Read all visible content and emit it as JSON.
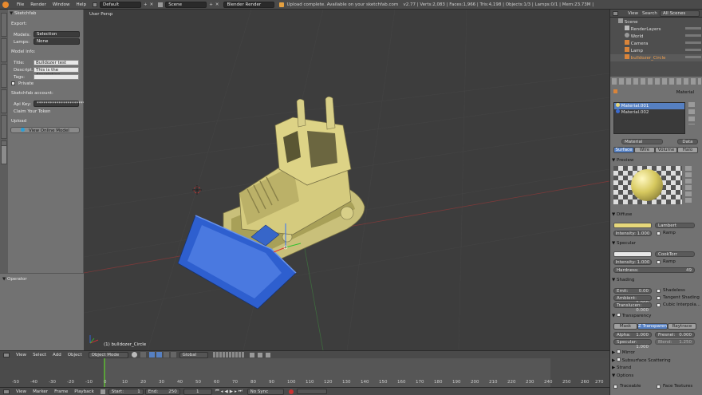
{
  "menubar": {
    "items": [
      "File",
      "Render",
      "Window",
      "Help"
    ],
    "layout": "Default",
    "scene": "Scene",
    "engine": "Blender Render",
    "message": "Upload complete. Available on your sketchfab.com dashboard",
    "stats": "v2.77 | Verts:2,083 | Faces:1,966 | Tris:4,198 | Objects:1/3 | Lamps:0/1 | Mem:23.73M | bulldozer_Circle"
  },
  "sketchfab": {
    "panel_title": "Sketchfab",
    "export_label": "Export:",
    "models_label": "Models:",
    "models_value": "Selection",
    "lamps_label": "Lamps:",
    "lamps_value": "None",
    "model_info_label": "Model info:",
    "title_label": "Title:",
    "title_value": "Bulldozer test",
    "description_label": "Descript...",
    "description_value": "This is the description",
    "tags_label": "Tags:",
    "tags_value": "",
    "private_label": "Private",
    "account_label": "Sketchfab account:",
    "api_key_label": "Api Key:",
    "api_key_value": "**********************",
    "claim_token_label": "Claim Your Token",
    "upload_label": "Upload",
    "view_online_label": "View Online Model"
  },
  "operator": {
    "title": "Operator"
  },
  "viewport": {
    "mode_label": "User Persp",
    "object_label": "(1) bulldozer_Circle"
  },
  "view3d_header": {
    "menus": [
      "View",
      "Select",
      "Add",
      "Object"
    ],
    "mode": "Object Mode",
    "orientation": "Global"
  },
  "timeline": {
    "ticks": [
      "-50",
      "-40",
      "-30",
      "-20",
      "-10",
      "0",
      "10",
      "20",
      "30",
      "40",
      "50",
      "60",
      "70",
      "80",
      "90",
      "100",
      "110",
      "120",
      "130",
      "140",
      "150",
      "160",
      "170",
      "180",
      "190",
      "200",
      "210",
      "220",
      "230",
      "240",
      "250",
      "260",
      "270",
      "280"
    ],
    "menus": [
      "View",
      "Marker",
      "Frame",
      "Playback"
    ],
    "start_label": "Start:",
    "start_value": "1",
    "end_label": "End:",
    "end_value": "250",
    "current_frame": "1",
    "sync": "No Sync"
  },
  "outliner": {
    "menus": [
      "View",
      "Search"
    ],
    "filter": "All Scenes",
    "items": [
      "Scene",
      "RenderLayers",
      "World",
      "Camera",
      "Lamp",
      "bulldozer_Circle"
    ]
  },
  "properties": {
    "material_slots": [
      "Material.001",
      "Material.002"
    ],
    "material_name": "Material",
    "data_label": "Data",
    "tabs": [
      "Surface",
      "Wire",
      "Volume",
      "Halo"
    ],
    "preview_label": "Preview",
    "diffuse": {
      "title": "Diffuse",
      "shader": "Lambert",
      "intensity": "Intensity: 1.000",
      "ramp": "Ramp",
      "color": "#e6d77a"
    },
    "specular": {
      "title": "Specular",
      "shader": "CookTorr",
      "intensity": "Intensity: 1.000",
      "ramp": "Ramp",
      "hardness": "Hardness:",
      "hardness_value": "49"
    },
    "shading": {
      "title": "Shading",
      "emit": "Emit:",
      "emit_value": "0.00",
      "ambient": "Ambient:",
      "ambient_value": "1.000",
      "translucency": "Translucen:",
      "translucency_value": "0.000",
      "shadeless": "Shadeless",
      "tangent": "Tangent Shading",
      "cubic": "Cubic Interpola..."
    },
    "transparency": {
      "title": "Transparency",
      "tabs": [
        "Mask",
        "Z Transparen",
        "Raytrace"
      ],
      "alpha": "Alpha:",
      "alpha_value": "1.000",
      "fresnel": "Fresnel:",
      "fresnel_value": "0.000",
      "specular": "Specular:",
      "specular_value": "1.000",
      "blend": "Blend:",
      "blend_value": "1.250"
    },
    "collapsed_panels": [
      "Mirror",
      "Subsurface Scattering",
      "Strand",
      "Options"
    ],
    "options": [
      "Traceable",
      "Face Textures"
    ]
  }
}
